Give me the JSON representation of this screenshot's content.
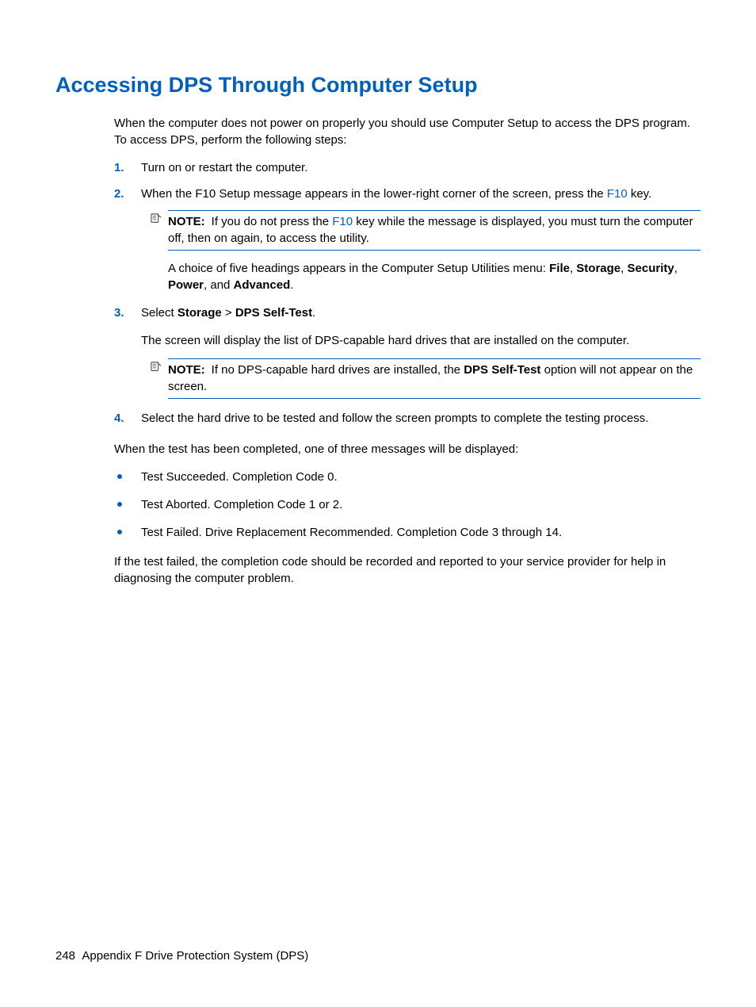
{
  "title": "Accessing DPS Through Computer Setup",
  "intro": "When the computer does not power on properly you should use Computer Setup to access the DPS program. To access DPS, perform the following steps:",
  "steps": {
    "s1": {
      "num": "1.",
      "text": "Turn on or restart the computer."
    },
    "s2": {
      "num": "2.",
      "pre": "When the F10 Setup message appears in the lower-right corner of the screen, press the ",
      "key": "F10",
      "post": " key.",
      "note_label": "NOTE:",
      "note_pre": "If you do not press the ",
      "note_key": "F10",
      "note_post": " key while the message is displayed, you must turn the computer off, then on again, to access the utility.",
      "after_pre": "A choice of five headings appears in the Computer Setup Utilities menu: ",
      "m_file": "File",
      "c1": ", ",
      "m_storage": "Storage",
      "c2": ", ",
      "m_security": "Security",
      "c3": ", ",
      "m_power": "Power",
      "c4": ", and ",
      "m_advanced": "Advanced",
      "after_end": "."
    },
    "s3": {
      "num": "3.",
      "t1": "Select ",
      "b1": "Storage",
      "t2": " > ",
      "b2": "DPS Self-Test",
      "t3": ".",
      "after": "The screen will display the list of DPS-capable hard drives that are installed on the computer.",
      "note_label": "NOTE:",
      "note_pre": "If no DPS-capable hard drives are installed, the ",
      "note_bold": "DPS Self-Test",
      "note_post": " option will not appear on the screen."
    },
    "s4": {
      "num": "4.",
      "text": "Select the hard drive to be tested and follow the screen prompts to complete the testing process."
    }
  },
  "post_steps": "When the test has been completed, one of three messages will be displayed:",
  "results": {
    "r1": "Test Succeeded. Completion Code 0.",
    "r2": "Test Aborted. Completion Code 1 or 2.",
    "r3": "Test Failed. Drive Replacement Recommended. Completion Code 3 through 14."
  },
  "closing": "If the test failed, the completion code should be recorded and reported to your service provider for help in diagnosing the computer problem.",
  "footer": {
    "page_num": "248",
    "section": "Appendix F   Drive Protection System (DPS)"
  }
}
